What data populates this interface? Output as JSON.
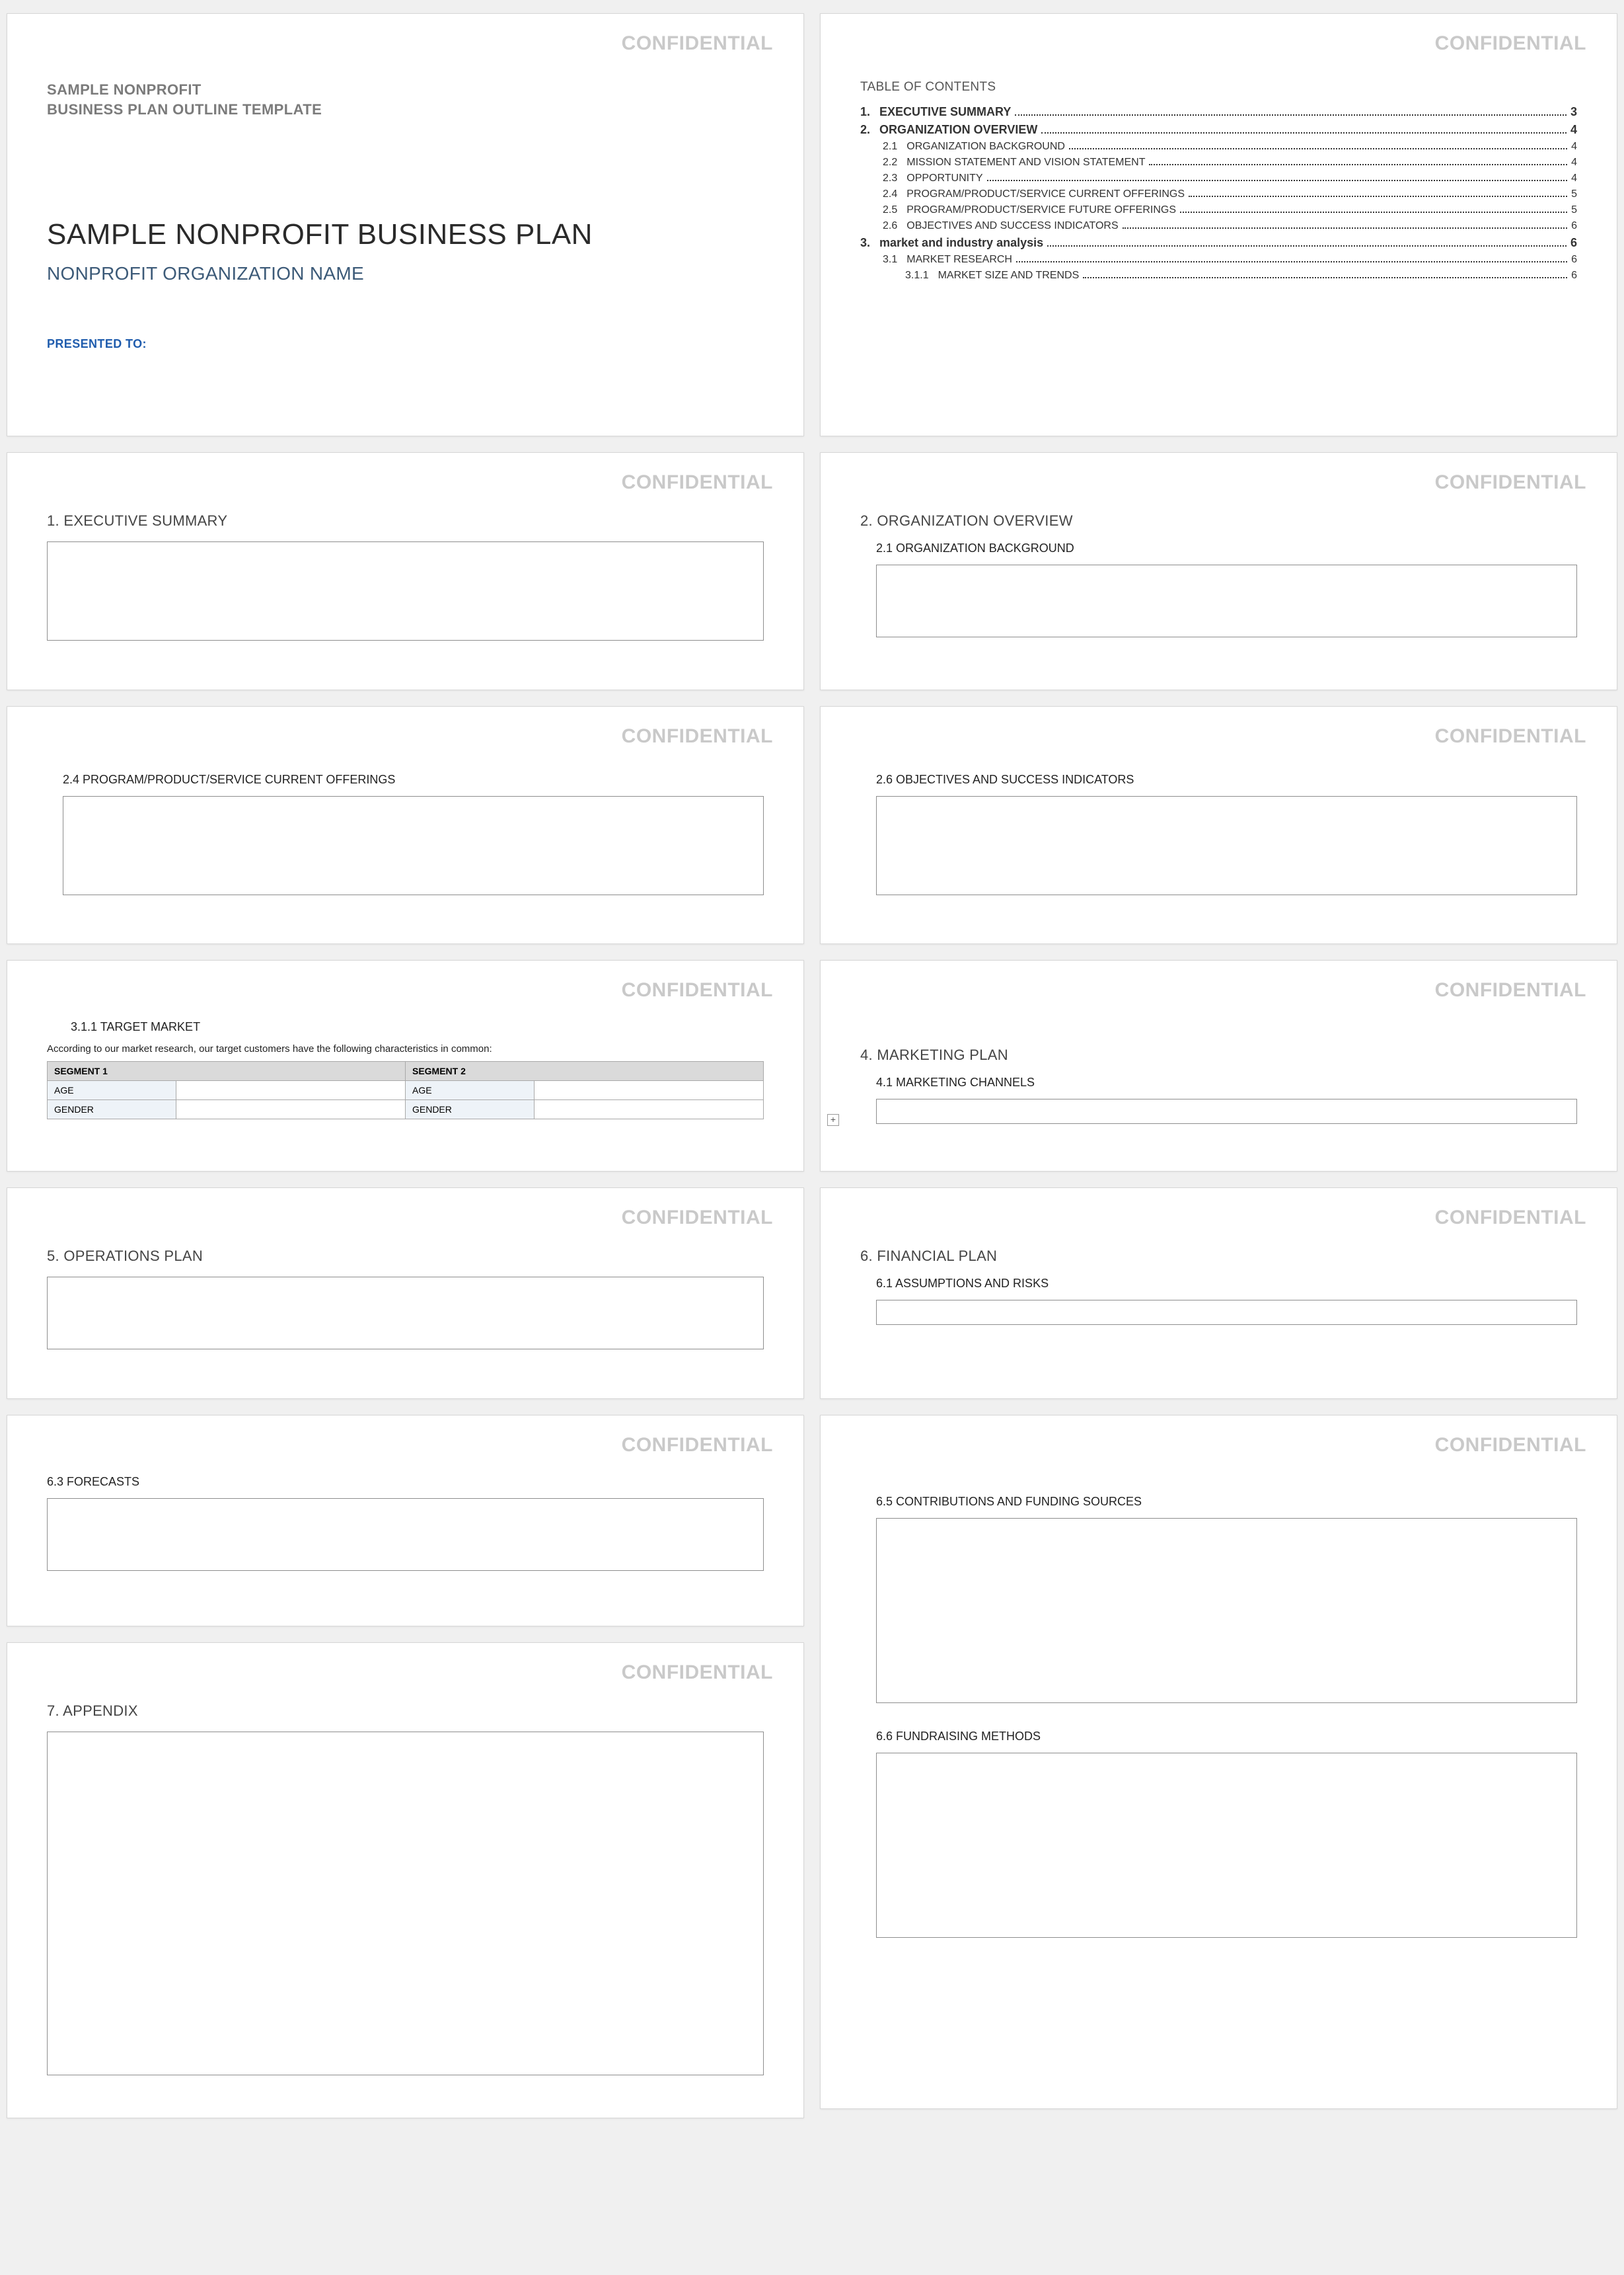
{
  "watermark": "CONFIDENTIAL",
  "cover": {
    "eyebrow_line1": "SAMPLE NONPROFIT",
    "eyebrow_line2": "BUSINESS PLAN OUTLINE TEMPLATE",
    "title": "SAMPLE NONPROFIT BUSINESS PLAN",
    "subtitle": "NONPROFIT ORGANIZATION NAME",
    "presented_label": "PRESENTED TO:"
  },
  "toc": {
    "title": "TABLE OF CONTENTS",
    "items": [
      {
        "lvl": 1,
        "num": "1.",
        "label": "EXECUTIVE SUMMARY",
        "page": "3"
      },
      {
        "lvl": 1,
        "num": "2.",
        "label": "ORGANIZATION OVERVIEW",
        "page": "4"
      },
      {
        "lvl": 2,
        "num": "2.1",
        "label": "ORGANIZATION BACKGROUND",
        "page": "4"
      },
      {
        "lvl": 2,
        "num": "2.2",
        "label": "MISSION STATEMENT AND VISION STATEMENT",
        "page": "4"
      },
      {
        "lvl": 2,
        "num": "2.3",
        "label": "OPPORTUNITY",
        "page": "4"
      },
      {
        "lvl": 2,
        "num": "2.4",
        "label": "PROGRAM/PRODUCT/SERVICE CURRENT OFFERINGS",
        "page": "5"
      },
      {
        "lvl": 2,
        "num": "2.5",
        "label": "PROGRAM/PRODUCT/SERVICE FUTURE OFFERINGS",
        "page": "5"
      },
      {
        "lvl": 2,
        "num": "2.6",
        "label": "OBJECTIVES AND SUCCESS INDICATORS",
        "page": "6"
      },
      {
        "lvl": 1,
        "num": "3.",
        "label": "market and industry analysis",
        "page": "6"
      },
      {
        "lvl": 2,
        "num": "3.1",
        "label": "MARKET RESEARCH",
        "page": "6"
      },
      {
        "lvl": 3,
        "num": "3.1.1",
        "label": "MARKET SIZE AND TRENDS",
        "page": "6"
      }
    ]
  },
  "sections": {
    "exec_summary": "1. EXECUTIVE SUMMARY",
    "org_overview": "2. ORGANIZATION OVERVIEW",
    "org_background": "2.1  ORGANIZATION BACKGROUND",
    "current_offerings": "2.4   PROGRAM/PRODUCT/SERVICE CURRENT OFFERINGS",
    "objectives": "2.6  OBJECTIVES AND SUCCESS INDICATORS",
    "target_market": "3.1.1   TARGET MARKET",
    "target_caption": "According to our market research, our target customers have the following characteristics in common:",
    "marketing_plan": "4. MARKETING PLAN",
    "marketing_channels": "4.1   MARKETING CHANNELS",
    "operations_plan": "5. OPERATIONS PLAN",
    "financial_plan": "6. FINANCIAL PLAN",
    "assumptions": "6.1   ASSUMPTIONS AND RISKS",
    "forecasts": "6.3    FORECASTS",
    "contributions": "6.5  CONTRIBUTIONS AND FUNDING SOURCES",
    "fundraising": "6.6  FUNDRAISING METHODS",
    "appendix": "7. APPENDIX"
  },
  "target_table": {
    "seg1": "SEGMENT 1",
    "seg2": "SEGMENT 2",
    "age": "AGE",
    "gender": "GENDER"
  },
  "expand_glyph": "+"
}
